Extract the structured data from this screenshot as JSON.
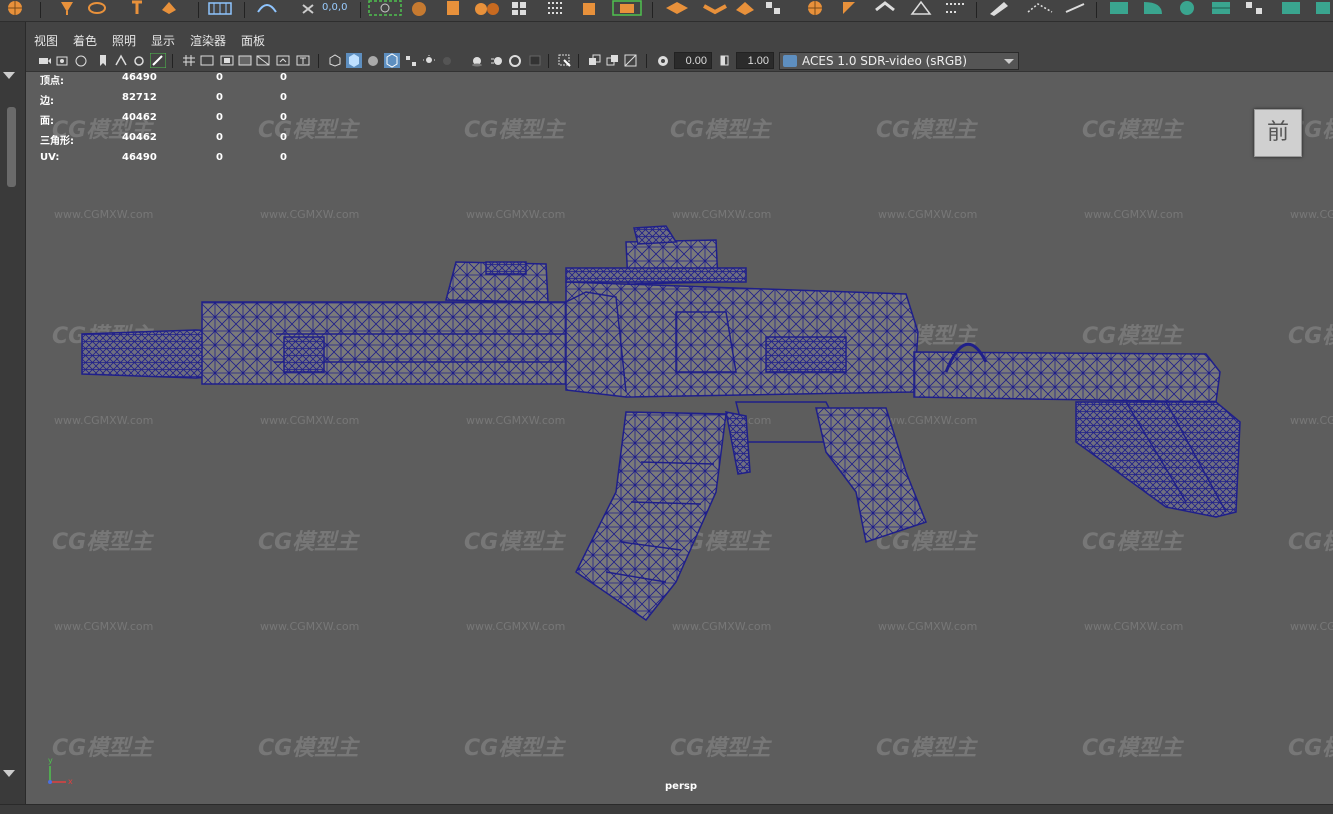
{
  "shelf": {
    "icons": [
      "poly-sphere-icon",
      "move-tool-icon",
      "rotate-tool-icon",
      "scale-tool-icon",
      "grid-icon",
      "snap-curve-icon",
      "snap-point-icon",
      "camera-select-icon",
      "cube-icon",
      "cylinder-icon",
      "sphere-icon",
      "plane-icon",
      "torus-icon",
      "cone-icon",
      "extrude-icon",
      "bevel-icon",
      "bridge-icon",
      "merge-icon",
      "pen-tool-icon",
      "multicut-icon",
      "boolean-icon",
      "mirror-icon"
    ],
    "coords": "0,0,0"
  },
  "menubar": {
    "items": [
      "视图",
      "着色",
      "照明",
      "显示",
      "渲染器",
      "面板"
    ]
  },
  "viewport_toolbar": {
    "exposure": "0.00",
    "gamma": "1.00",
    "colorspace": "ACES 1.0 SDR-video (sRGB)"
  },
  "hud": {
    "rows": [
      {
        "label": "顶点:",
        "v1": "46490",
        "v2": "0",
        "v3": "0"
      },
      {
        "label": "边:",
        "v1": "82712",
        "v2": "0",
        "v3": "0"
      },
      {
        "label": "面:",
        "v1": "40462",
        "v2": "0",
        "v3": "0"
      },
      {
        "label": "三角形:",
        "v1": "40462",
        "v2": "0",
        "v3": "0"
      },
      {
        "label": "UV:",
        "v1": "46490",
        "v2": "0",
        "v3": "0"
      }
    ]
  },
  "view_cube": {
    "face": "前"
  },
  "camera": {
    "name": "persp"
  },
  "axis": {
    "x": "x",
    "y": "y"
  },
  "watermark": {
    "logo": "CG模型主",
    "url": "www.CGMXW.com"
  },
  "colors": {
    "wireframe": "#1f1f8a",
    "viewport_bg": "#5d5d5d",
    "ui_bg": "#444444",
    "accent_orange": "#e8913b",
    "accent_teal": "#3aa58f"
  }
}
